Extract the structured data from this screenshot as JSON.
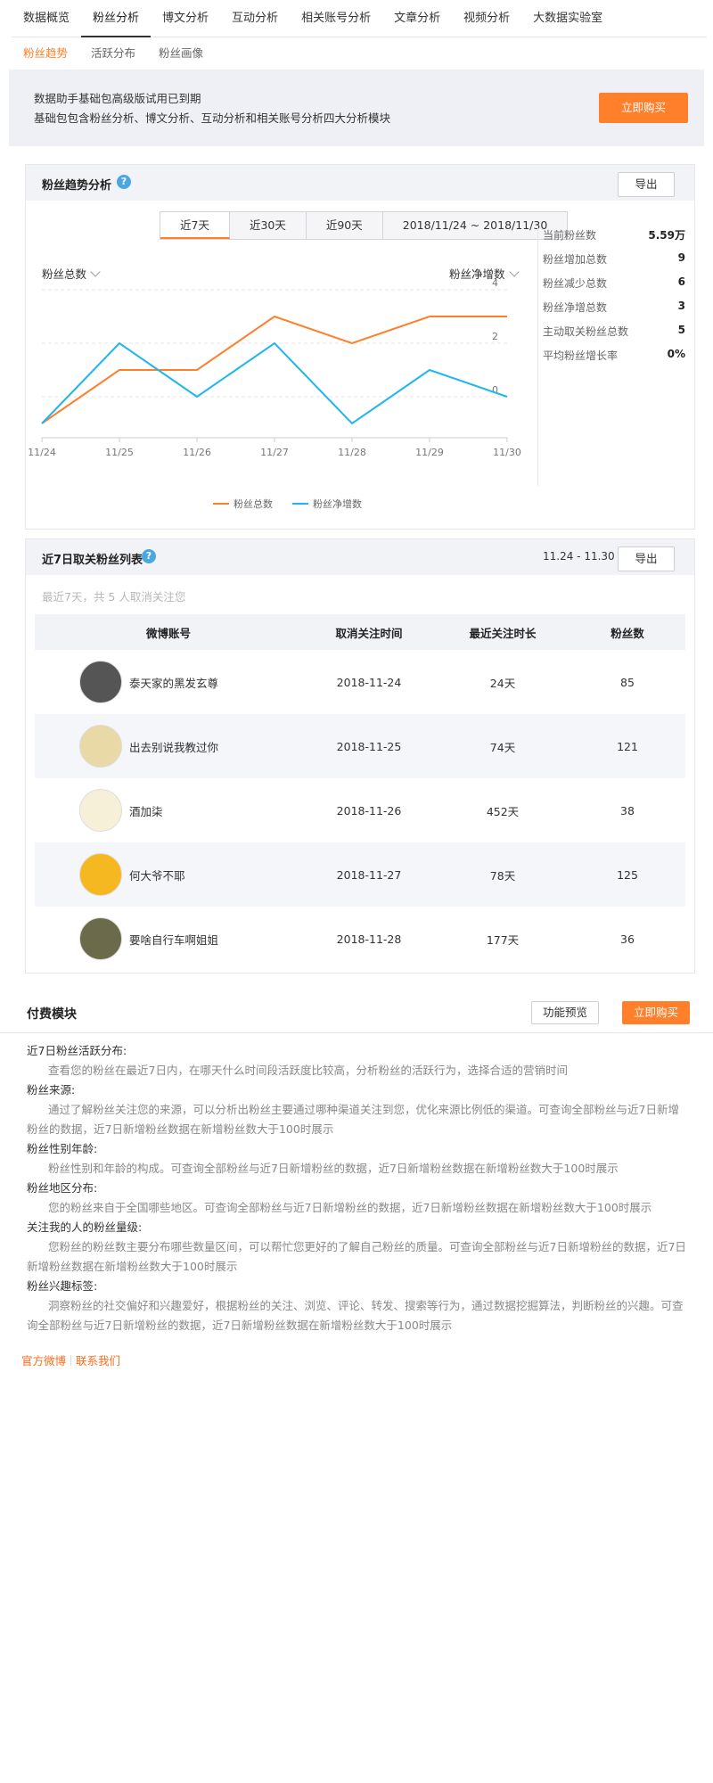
{
  "nav": {
    "tabs": [
      "数据概览",
      "粉丝分析",
      "博文分析",
      "互动分析",
      "相关账号分析",
      "文章分析",
      "视频分析",
      "大数据实验室"
    ],
    "active_index": 1,
    "subtabs": [
      "粉丝趋势",
      "活跃分布",
      "粉丝画像"
    ],
    "active_sub_index": 0
  },
  "notice": {
    "line1": "数据助手基础包高级版试用已到期",
    "line2": "基础包包含粉丝分析、博文分析、互动分析和相关账号分析四大分析模块",
    "buy_label": "立即购买"
  },
  "trend": {
    "title": "粉丝趋势分析",
    "help": "?",
    "export_label": "导出",
    "ranges": [
      "近7天",
      "近30天",
      "近90天",
      "2018/11/24 ~ 2018/11/30"
    ],
    "active_range": 0,
    "left_select": "粉丝总数",
    "right_select": "粉丝净增数",
    "stats": [
      {
        "label": "当前粉丝数",
        "value": "5.59万"
      },
      {
        "label": "粉丝增加总数",
        "value": "9"
      },
      {
        "label": "粉丝减少总数",
        "value": "6"
      },
      {
        "label": "粉丝净增总数",
        "value": "3"
      },
      {
        "label": "主动取关粉丝总数",
        "value": "5"
      },
      {
        "label": "平均粉丝增长率",
        "value": "0%"
      }
    ]
  },
  "chart_data": {
    "type": "line",
    "x": [
      "11/24",
      "11/25",
      "11/26",
      "11/27",
      "11/28",
      "11/29",
      "11/30"
    ],
    "y_right_ticks": [
      "4",
      "2",
      "0"
    ],
    "ylim_right": [
      -1,
      4
    ],
    "series": [
      {
        "name": "粉丝总数",
        "color": "#ff7f2a",
        "values": [
          -1,
          1,
          1,
          3,
          2,
          3,
          3
        ]
      },
      {
        "name": "粉丝净增数",
        "color": "#1fb5ee",
        "values": [
          -1,
          2,
          0,
          2,
          -1,
          1,
          0
        ]
      }
    ],
    "grid": true,
    "legend": "bottom-center"
  },
  "unfollow": {
    "title": "近7日取关粉丝列表",
    "help": "?",
    "date_range": "11.24 - 11.30",
    "export_label": "导出",
    "note": "最近7天，共 5 人取消关注您",
    "columns": [
      "微博账号",
      "取消关注时间",
      "最近关注时长",
      "粉丝数"
    ],
    "rows": [
      {
        "name": "泰天家的黑发玄尊",
        "time": "2018-11-24",
        "duration": "24天",
        "fans": "85",
        "avatar_color": "#555555"
      },
      {
        "name": "出去别说我教过你",
        "time": "2018-11-25",
        "duration": "74天",
        "fans": "121",
        "avatar_color": "#e9d9a6"
      },
      {
        "name": "酒加柒",
        "time": "2018-11-26",
        "duration": "452天",
        "fans": "38",
        "avatar_color": "#f7f0d8"
      },
      {
        "name": "何大爷不耶",
        "time": "2018-11-27",
        "duration": "78天",
        "fans": "125",
        "avatar_color": "#f5b820"
      },
      {
        "name": "要啥自行车啊姐姐",
        "time": "2018-11-28",
        "duration": "177天",
        "fans": "36",
        "avatar_color": "#6b6a4a"
      }
    ]
  },
  "paid": {
    "title": "付费模块",
    "preview_label": "功能预览",
    "buy_label": "立即购买",
    "items": [
      {
        "h": "近7日粉丝活跃分布:",
        "d": "查看您的粉丝在最近7日内，在哪天什么时间段活跃度比较高，分析粉丝的活跃行为，选择合适的营销时间"
      },
      {
        "h": "粉丝来源:",
        "d": "通过了解粉丝关注您的来源，可以分析出粉丝主要通过哪种渠道关注到您，优化来源比例低的渠道。可查询全部粉丝与近7日新增粉丝的数据，近7日新增粉丝数据在新增粉丝数大于100时展示"
      },
      {
        "h": "粉丝性别年龄:",
        "d": "粉丝性别和年龄的构成。可查询全部粉丝与近7日新增粉丝的数据，近7日新增粉丝数据在新增粉丝数大于100时展示"
      },
      {
        "h": "粉丝地区分布:",
        "d": "您的粉丝来自于全国哪些地区。可查询全部粉丝与近7日新增粉丝的数据，近7日新增粉丝数据在新增粉丝数大于100时展示"
      },
      {
        "h": "关注我的人的粉丝量级:",
        "d": "您粉丝的粉丝数主要分布哪些数量区间，可以帮忙您更好的了解自己粉丝的质量。可查询全部粉丝与近7日新增粉丝的数据，近7日新增粉丝数据在新增粉丝数大于100时展示"
      },
      {
        "h": "粉丝兴趣标签:",
        "d": "洞察粉丝的社交偏好和兴趣爱好，根据粉丝的关注、浏览、评论、转发、搜索等行为，通过数据挖掘算法，判断粉丝的兴趣。可查询全部粉丝与近7日新增粉丝的数据，近7日新增粉丝数据在新增粉丝数大于100时展示"
      }
    ]
  },
  "footer": {
    "links": [
      "官方微博",
      "联系我们"
    ]
  }
}
